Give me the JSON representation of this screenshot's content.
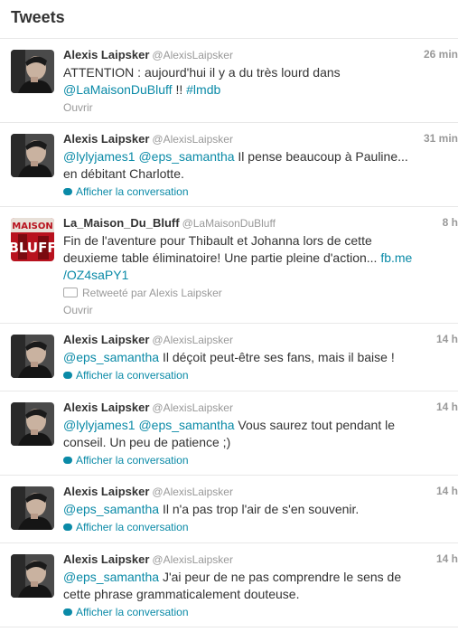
{
  "header": {
    "title": "Tweets"
  },
  "tweets": [
    {
      "name": "Alexis Laipsker",
      "handle": "@AlexisLaipsker",
      "time": "26 min",
      "line1": [
        {
          "t": "ATTENTION : aujourd'hui il y a du très lourd dans"
        }
      ],
      "line2": [
        {
          "t": "@LaMaisonDuBluff",
          "l": true
        },
        {
          "t": " !! "
        },
        {
          "t": "#lmdb",
          "l": true
        }
      ],
      "action": "Ouvrir",
      "avatar": "person"
    },
    {
      "name": "Alexis Laipsker",
      "handle": "@AlexisLaipsker",
      "time": "31 min",
      "line1": [
        {
          "t": "@lylyjames1",
          "l": true
        },
        {
          "t": " "
        },
        {
          "t": "@eps_samantha",
          "l": true
        },
        {
          "t": " Il pense beaucoup à Pauline..."
        }
      ],
      "line2": [
        {
          "t": "en débitant Charlotte."
        }
      ],
      "conversation": "Afficher la conversation",
      "avatar": "person"
    },
    {
      "name": "La_Maison_Du_Bluff",
      "handle": "@LaMaisonDuBluff",
      "time": "8 h",
      "line1": [
        {
          "t": "Fin de l'aventure pour Thibault et Johanna lors de cette"
        }
      ],
      "line2": [
        {
          "t": "deuxieme table éliminatoire! Une partie pleine d'action... "
        },
        {
          "t": "fb.me",
          "l": true
        }
      ],
      "line3": [
        {
          "t": "/OZ4saPY1",
          "l": true
        }
      ],
      "retweet": "Retweeté par Alexis Laipsker",
      "action": "Ouvrir",
      "avatar": "logo",
      "logo_text": [
        "MAISON",
        "BLUFF"
      ]
    },
    {
      "name": "Alexis Laipsker",
      "handle": "@AlexisLaipsker",
      "time": "14 h",
      "line1": [
        {
          "t": "@eps_samantha",
          "l": true
        },
        {
          "t": " Il déçoit peut-être ses fans, mais il baise !"
        }
      ],
      "conversation": "Afficher la conversation",
      "avatar": "person"
    },
    {
      "name": "Alexis Laipsker",
      "handle": "@AlexisLaipsker",
      "time": "14 h",
      "line1": [
        {
          "t": "@lylyjames1",
          "l": true
        },
        {
          "t": " "
        },
        {
          "t": "@eps_samantha",
          "l": true
        },
        {
          "t": " Vous saurez tout pendant le"
        }
      ],
      "line2": [
        {
          "t": "conseil. Un peu de patience ;)"
        }
      ],
      "conversation": "Afficher la conversation",
      "avatar": "person"
    },
    {
      "name": "Alexis Laipsker",
      "handle": "@AlexisLaipsker",
      "time": "14 h",
      "line1": [
        {
          "t": "@eps_samantha",
          "l": true
        },
        {
          "t": " Il n'a pas trop l'air de s'en souvenir."
        }
      ],
      "conversation": "Afficher la conversation",
      "avatar": "person"
    },
    {
      "name": "Alexis Laipsker",
      "handle": "@AlexisLaipsker",
      "time": "14 h",
      "line1": [
        {
          "t": "@eps_samantha",
          "l": true
        },
        {
          "t": " J'ai peur de ne pas comprendre le sens de"
        }
      ],
      "line2": [
        {
          "t": "cette phrase grammaticalement douteuse."
        }
      ],
      "conversation": "Afficher la conversation",
      "avatar": "person"
    }
  ]
}
